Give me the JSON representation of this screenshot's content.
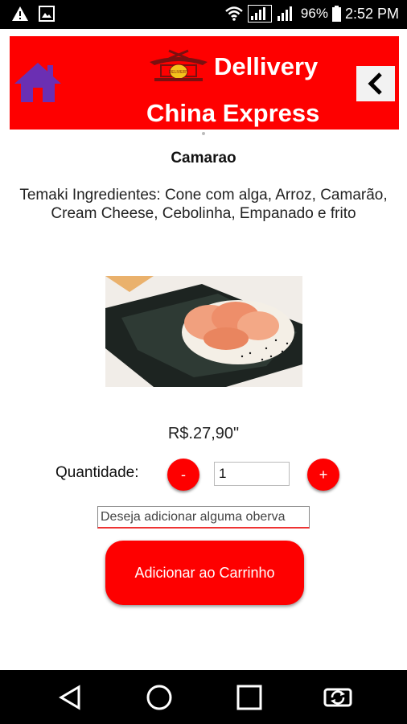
{
  "status_bar": {
    "battery": "96%",
    "time": "2:52 PM",
    "icons": [
      "warning-icon",
      "image-icon",
      "wifi-icon",
      "signal-4g-icon",
      "signal-3g-icon",
      "battery-icon"
    ]
  },
  "header": {
    "title_line1": "Dellivery",
    "title_line2": "China Express",
    "logo_text": "DELIVERY",
    "background_color": "#fe0000",
    "home_icon": "home-icon",
    "back_icon": "chevron-left-icon"
  },
  "product": {
    "name": "Camarao",
    "description": "Temaki Ingredientes: Cone com alga, Arroz, Camarão, Cream Cheese, Cebolinha, Empanado e frito",
    "price": "R$.27,90\""
  },
  "quantity": {
    "label": "Quantidade:",
    "minus_label": "-",
    "plus_label": "+",
    "value": "1"
  },
  "observation": {
    "placeholder": "Deseja adicionar alguma oberva"
  },
  "add_button": {
    "label": "Adicionar ao Carrinho"
  },
  "nav_bar": {
    "icons": [
      "back-triangle-icon",
      "home-circle-icon",
      "recents-square-icon",
      "rotate-screen-icon"
    ]
  }
}
